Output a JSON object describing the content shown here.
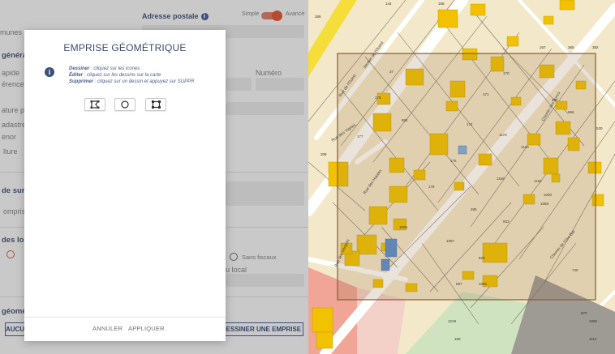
{
  "form": {
    "postal_address_label": "Adresse postale",
    "mode_simple": "Simple",
    "mode_advanced": "Avancé",
    "communes_fragment": "munes",
    "section_general": "générale",
    "rapid_fragment": "apide",
    "reference_fragment": "érence",
    "numero_label": "Numéro",
    "nature_fragment": "ature p",
    "cadastral_fragment": "adastre",
    "tenor_fragment": "enor",
    "culture_fragment": "lture",
    "section_surface": "de surf",
    "compris_fragment": "ompris",
    "section_locaux": "des loc",
    "sans_fiscaux": "Sans fiscaux",
    "local_fragment": "u local",
    "section_geom": "géomé",
    "aucun_button": "AUCUN",
    "draw_button": "DESSINER UNE EMPRISE"
  },
  "modal": {
    "title": "EMPRISE GÉOMÉTRIQUE",
    "instructions": [
      {
        "key": "Dessiner",
        "text": " : cliquez sur les icones"
      },
      {
        "key": "Éditer",
        "text": " : cliquez sur les dessins sur la carte"
      },
      {
        "key": "Supprimer",
        "text": " : cliquez sur un dessin et appuyez sur SUPPR"
      }
    ],
    "tools": [
      {
        "icon": "polygon-icon"
      },
      {
        "icon": "circle-icon"
      },
      {
        "icon": "rectangle-icon"
      }
    ],
    "cancel_label": "ANNULER",
    "apply_label": "APPLIQUER"
  },
  "map": {
    "streets": [
      "Rue de l'Ouest",
      "Sentier de l'Ouest",
      "Rue des Vignes",
      "Rue des Hautes",
      "Rue des Vergers",
      "Chemin des Joncs",
      "Chemin de l'Ore Bal"
    ],
    "parcels": [
      "285",
      "144",
      "158",
      "167",
      "365",
      "382",
      "37",
      "170",
      "176",
      "171",
      "362",
      "966",
      "177",
      "174",
      "1170",
      "530",
      "984",
      "175",
      "1169",
      "1164",
      "1160",
      "208",
      "178",
      "1000",
      "1068",
      "1005",
      "285",
      "933",
      "1097",
      "829",
      "697",
      "1096",
      "160",
      "1219",
      "870",
      "1086",
      "1112",
      "740"
    ],
    "colors": {
      "background": "#f3e8c9",
      "building": "#f2c200",
      "parcel_line": "#7d7467",
      "road": "#ffffff",
      "green_zone": "#cfe3c0",
      "red_zone": "#f0a596",
      "selection": "#8b5a2b"
    }
  }
}
